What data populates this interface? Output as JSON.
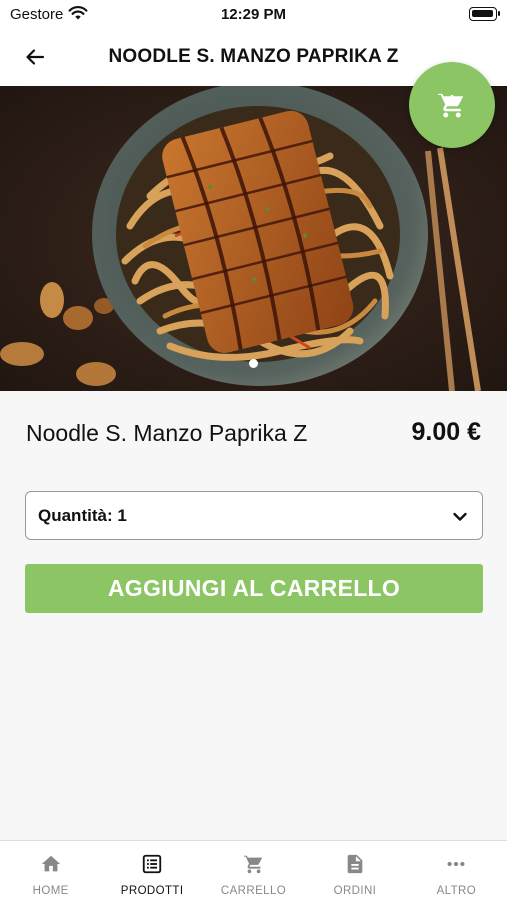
{
  "status_bar": {
    "carrier": "Gestore",
    "time": "12:29 PM"
  },
  "header": {
    "title": "NOODLE S. MANZO PAPRIKA Z"
  },
  "product": {
    "name": "Noodle S. Manzo Paprika Z",
    "price": "9.00 €"
  },
  "quantity": {
    "label": "Quantità: 1"
  },
  "add_to_cart": {
    "label": "AGGIUNGI AL CARRELLO"
  },
  "tabs": [
    {
      "label": "HOME",
      "icon": "home-icon"
    },
    {
      "label": "PRODOTTI",
      "icon": "list-icon",
      "active": true
    },
    {
      "label": "CARRELLO",
      "icon": "cart-icon"
    },
    {
      "label": "ORDINI",
      "icon": "document-icon"
    },
    {
      "label": "ALTRO",
      "icon": "more-icon"
    }
  ],
  "colors": {
    "accent": "#8cc563",
    "text": "#111111",
    "inactive": "#888888"
  }
}
